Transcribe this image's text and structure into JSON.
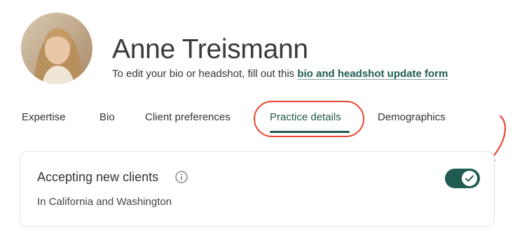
{
  "profile": {
    "name": "Anne Treismann",
    "edit_text": "To edit your bio or headshot, fill out this ",
    "edit_link": "bio and headshot update form"
  },
  "tabs": [
    {
      "label": "Expertise",
      "active": false
    },
    {
      "label": "Bio",
      "active": false
    },
    {
      "label": "Client preferences",
      "active": false
    },
    {
      "label": "Practice details",
      "active": true
    },
    {
      "label": "Demographics",
      "active": false
    }
  ],
  "card": {
    "title": "Accepting new clients",
    "subtitle": "In California and Washington",
    "toggle_on": true
  },
  "icons": {
    "info": "info-circle-icon",
    "check": "check-icon",
    "arrow": "annotation-arrow-icon"
  },
  "colors": {
    "accent": "#1f5b50",
    "annotation": "#e8482f",
    "card_border": "#e3e3e3"
  }
}
